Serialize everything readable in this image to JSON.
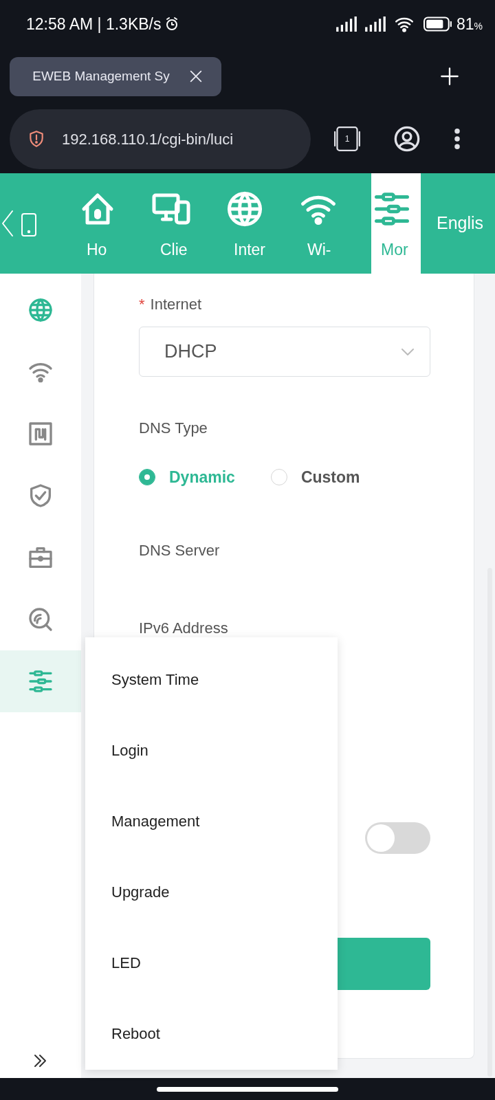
{
  "status_bar": {
    "time": "12:58 AM | 1.3KB/s",
    "battery": "81",
    "battery_unit": "%"
  },
  "browser": {
    "tab_title": "EWEB Management Sy",
    "url": "192.168.110.1/cgi-bin/luci",
    "tab_count": "1"
  },
  "top_nav": {
    "items": [
      {
        "label": "Ho",
        "selected": false
      },
      {
        "label": "Clie",
        "selected": false
      },
      {
        "label": "Inter",
        "selected": false
      },
      {
        "label": "Wi-",
        "selected": false
      },
      {
        "label": "Mor",
        "selected": true
      }
    ],
    "language": "Englis"
  },
  "sidebar": {
    "items": [
      {
        "selected": false
      },
      {
        "selected": false
      },
      {
        "selected": false
      },
      {
        "selected": false
      },
      {
        "selected": false
      },
      {
        "selected": false
      },
      {
        "selected": true
      }
    ]
  },
  "form": {
    "required_mark": "*",
    "internet_label": "Internet",
    "internet_value": "DHCP",
    "dns_type_label": "DNS Type",
    "dns_options": [
      {
        "label": "Dynamic",
        "selected": true
      },
      {
        "label": "Custom",
        "selected": false
      }
    ],
    "dns_server_label": "DNS Server",
    "ipv6_label": "IPv6 Address",
    "toggle": {
      "on": false
    }
  },
  "menu": {
    "items": [
      {
        "label": "System Time"
      },
      {
        "label": "Login"
      },
      {
        "label": "Management"
      },
      {
        "label": "Upgrade"
      },
      {
        "label": "LED"
      },
      {
        "label": "Reboot"
      }
    ]
  }
}
